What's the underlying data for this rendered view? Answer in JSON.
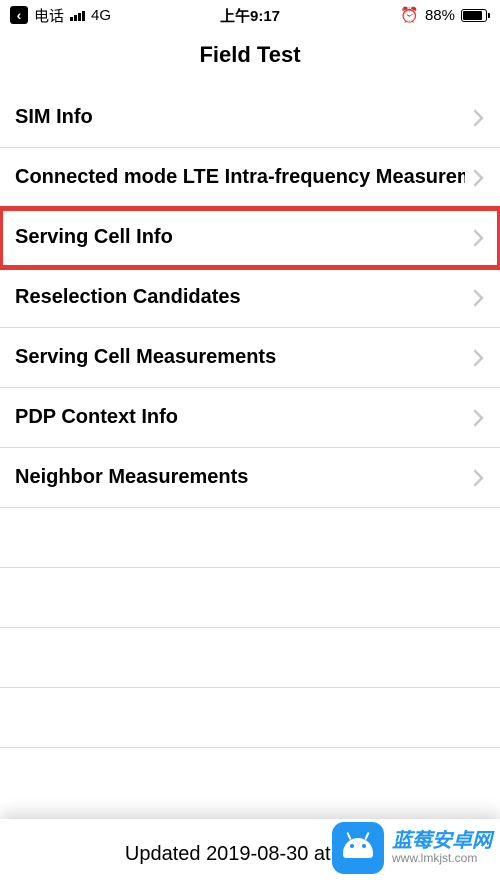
{
  "status_bar": {
    "carrier": "电话",
    "network": "4G",
    "time": "上午9:17",
    "battery_percent": "88%"
  },
  "header": {
    "title": "Field Test"
  },
  "menu": {
    "items": [
      {
        "label": "SIM Info",
        "highlighted": false
      },
      {
        "label": "Connected mode LTE Intra-frequency Measurement",
        "highlighted": false
      },
      {
        "label": "Serving Cell Info",
        "highlighted": true
      },
      {
        "label": "Reselection Candidates",
        "highlighted": false
      },
      {
        "label": "Serving Cell Measurements",
        "highlighted": false
      },
      {
        "label": "PDP Context Info",
        "highlighted": false
      },
      {
        "label": "Neighbor Measurements",
        "highlighted": false
      },
      {
        "label": "",
        "highlighted": false
      },
      {
        "label": "",
        "highlighted": false
      },
      {
        "label": "",
        "highlighted": false
      },
      {
        "label": "",
        "highlighted": false
      }
    ]
  },
  "footer": {
    "updated_text": "Updated 2019-08-30 at 09:1"
  },
  "watermark": {
    "title": "蓝莓安卓网",
    "url": "www.lmkjst.com"
  }
}
